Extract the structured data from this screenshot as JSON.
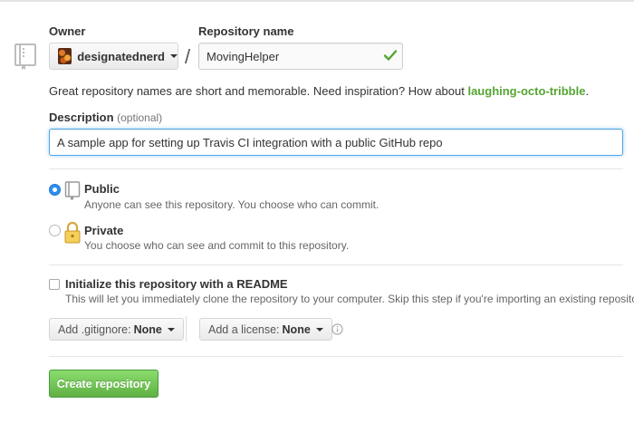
{
  "owner": {
    "label": "Owner",
    "selected": "designatednerd"
  },
  "repository": {
    "label": "Repository name",
    "separator": "/",
    "value": "MovingHelper"
  },
  "hint": {
    "text": "Great repository names are short and memorable. Need inspiration? How about ",
    "suggestion": "laughing-octo-tribble",
    "suffix": "."
  },
  "description": {
    "label": "Description",
    "optional": "(optional)",
    "value": "A sample app for setting up Travis CI integration with a public GitHub repo"
  },
  "visibility": {
    "selected": "public",
    "options": [
      {
        "title": "Public",
        "description": "Anyone can see this repository. You choose who can commit."
      },
      {
        "title": "Private",
        "description": "You choose who can see and commit to this repository."
      }
    ]
  },
  "readme": {
    "checked": false,
    "title": "Initialize this repository with a README",
    "description": "This will let you immediately clone the repository to your computer. Skip this step if you're importing an existing repository."
  },
  "gitignore": {
    "label": "Add .gitignore:",
    "value": "None"
  },
  "license": {
    "label": "Add a license:",
    "value": "None"
  },
  "submit": {
    "label": "Create repository"
  },
  "colors": {
    "accent_blue": "#2f8ff3",
    "success_green": "#55a532",
    "button_green": "#60b044",
    "focus_border": "#51a7e8"
  }
}
